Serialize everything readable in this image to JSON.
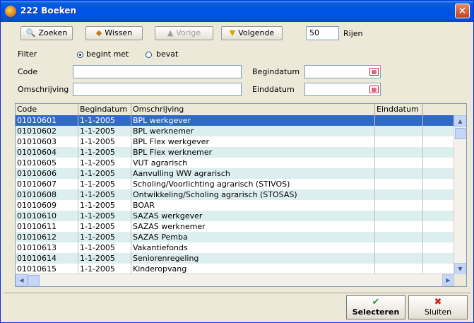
{
  "window": {
    "title": "222 Boeken",
    "close_glyph": "✕"
  },
  "toolbar": {
    "zoeken": "Zoeken",
    "wissen": "Wissen",
    "vorige": "Vorige",
    "volgende": "Volgende",
    "rows_value": "50",
    "rows_label": "Rijen",
    "icons": {
      "zoeken": "binoculars-icon",
      "wissen": "eraser-icon",
      "vorige": "arrow-up-icon",
      "volgende": "arrow-down-icon"
    }
  },
  "filter": {
    "label": "Filter",
    "option_begins": "begint met",
    "option_contains": "bevat",
    "selected": "begint met"
  },
  "fields": {
    "code_label": "Code",
    "code_value": "",
    "omschrijving_label": "Omschrijving",
    "omschrijving_value": "",
    "begindatum_label": "Begindatum",
    "begindatum_value": "",
    "einddatum_label": "Einddatum",
    "einddatum_value": ""
  },
  "grid": {
    "columns": [
      "Code",
      "Begindatum",
      "Omschrijving",
      "Einddatum"
    ],
    "selected_index": 0,
    "rows": [
      {
        "code": "01010601",
        "begindatum": "1-1-2005",
        "omschrijving": "BPL werkgever",
        "einddatum": ""
      },
      {
        "code": "01010602",
        "begindatum": "1-1-2005",
        "omschrijving": "BPL werknemer",
        "einddatum": ""
      },
      {
        "code": "01010603",
        "begindatum": "1-1-2005",
        "omschrijving": "BPL Flex werkgever",
        "einddatum": ""
      },
      {
        "code": "01010604",
        "begindatum": "1-1-2005",
        "omschrijving": "BPL Flex werknemer",
        "einddatum": ""
      },
      {
        "code": "01010605",
        "begindatum": "1-1-2005",
        "omschrijving": "VUT agrarisch",
        "einddatum": ""
      },
      {
        "code": "01010606",
        "begindatum": "1-1-2005",
        "omschrijving": "Aanvulling WW agrarisch",
        "einddatum": ""
      },
      {
        "code": "01010607",
        "begindatum": "1-1-2005",
        "omschrijving": "Scholing/Voorlichting agrarisch (STIVOS)",
        "einddatum": ""
      },
      {
        "code": "01010608",
        "begindatum": "1-1-2005",
        "omschrijving": "Ontwikkeling/Scholing agrarisch (STOSAS)",
        "einddatum": ""
      },
      {
        "code": "01010609",
        "begindatum": "1-1-2005",
        "omschrijving": "BOAR",
        "einddatum": ""
      },
      {
        "code": "01010610",
        "begindatum": "1-1-2005",
        "omschrijving": "SAZAS werkgever",
        "einddatum": ""
      },
      {
        "code": "01010611",
        "begindatum": "1-1-2005",
        "omschrijving": "SAZAS werknemer",
        "einddatum": ""
      },
      {
        "code": "01010612",
        "begindatum": "1-1-2005",
        "omschrijving": "SAZAS Pemba",
        "einddatum": ""
      },
      {
        "code": "01010613",
        "begindatum": "1-1-2005",
        "omschrijving": "Vakantiefonds",
        "einddatum": ""
      },
      {
        "code": "01010614",
        "begindatum": "1-1-2005",
        "omschrijving": "Seniorenregeling",
        "einddatum": ""
      },
      {
        "code": "01010615",
        "begindatum": "1-1-2005",
        "omschrijving": "Kinderopvang",
        "einddatum": ""
      }
    ]
  },
  "footer": {
    "selecteren": "Selecteren",
    "sluiten": "Sluiten",
    "selecteren_glyph": "✔",
    "sluiten_glyph": "✖"
  },
  "colors": {
    "title_bar": "#0054e3",
    "selection": "#316ac5",
    "alt_row": "#ddeeee",
    "window_bg": "#ece9d8"
  }
}
